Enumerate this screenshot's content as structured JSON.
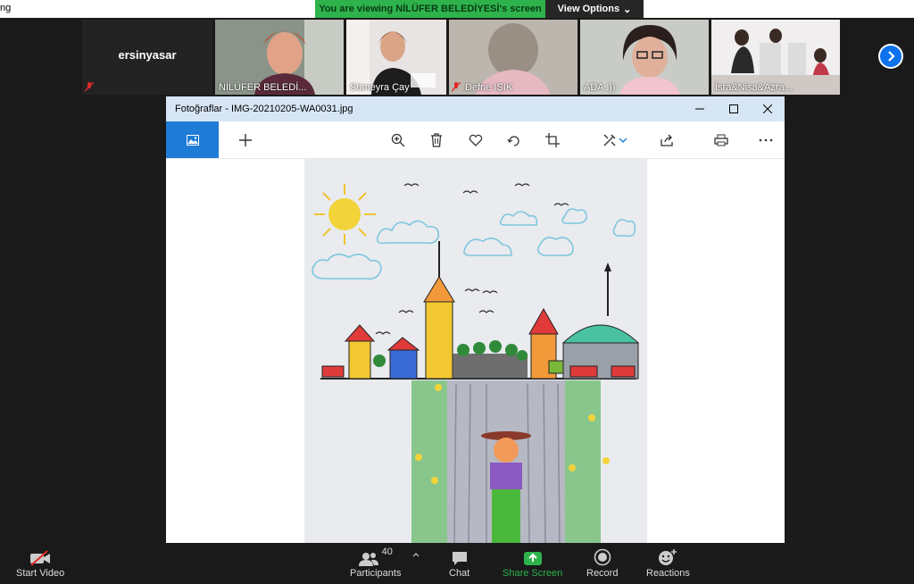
{
  "top": {
    "left_text": "ng",
    "banner_message": "You are viewing NİLÜFER BELEDİYESİ's screen",
    "view_options_label": "View Options"
  },
  "participants_strip": [
    {
      "name": "ersinyasar",
      "kind": "name-only",
      "muted": true
    },
    {
      "name": "NİLÜFER BELEDİ...",
      "kind": "video",
      "muted": false,
      "active": true
    },
    {
      "name": "Sümeyra  Çay",
      "kind": "video",
      "muted": false
    },
    {
      "name": "Defne IŞIK",
      "kind": "video",
      "muted": true
    },
    {
      "name": "ADA :))",
      "kind": "video",
      "muted": false
    },
    {
      "name": "İsra&Nisa&Azra...",
      "kind": "video",
      "muted": false
    }
  ],
  "photo_window": {
    "title": "Fotoğraflar - IMG-20210205-WA0031.jpg",
    "toolbar_icons": [
      "image-icon",
      "add-icon",
      "zoom-in-icon",
      "delete-icon",
      "heart-icon",
      "rotate-icon",
      "crop-icon",
      "edit-icon",
      "chevron-down-icon",
      "share-icon",
      "print-icon",
      "more-icon"
    ]
  },
  "bottom_bar": {
    "start_video": "Start Video",
    "participants": "Participants",
    "participants_count": "40",
    "chat": "Chat",
    "share_screen": "Share Screen",
    "record": "Record",
    "reactions": "Reactions"
  },
  "colors": {
    "share_green": "#2eb34c",
    "titlebar_blue": "#d7e6f5",
    "accent_blue": "#1e7bd6",
    "zoom_blue": "#0e72ed"
  }
}
